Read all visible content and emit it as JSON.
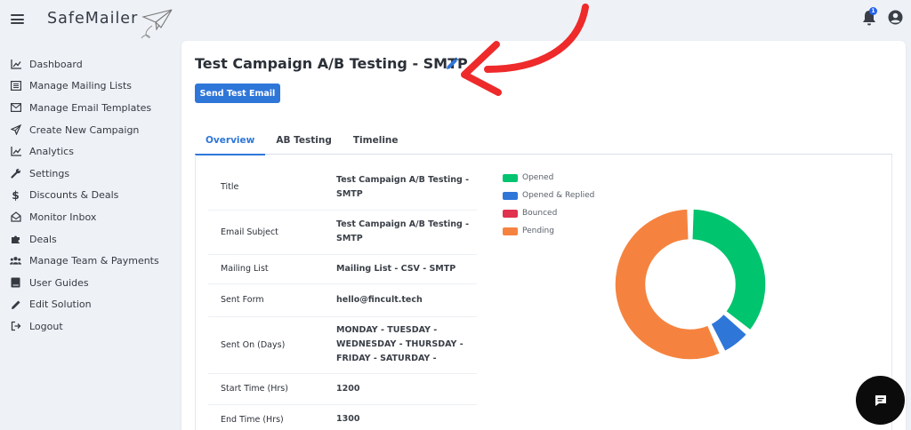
{
  "header": {
    "logo_text": "SafeMailer",
    "notification_count": "1"
  },
  "sidebar": {
    "items": [
      {
        "label": "Dashboard",
        "icon": "chart-line-icon"
      },
      {
        "label": "Manage Mailing Lists",
        "icon": "list-icon"
      },
      {
        "label": "Manage Email Templates",
        "icon": "envelope-icon"
      },
      {
        "label": "Create New Campaign",
        "icon": "paper-plane-icon"
      },
      {
        "label": "Analytics",
        "icon": "chart-line-icon"
      },
      {
        "label": "Settings",
        "icon": "wrench-icon"
      },
      {
        "label": "Discounts & Deals",
        "icon": "dollar-icon"
      },
      {
        "label": "Monitor Inbox",
        "icon": "inbox-icon"
      },
      {
        "label": "Deals",
        "icon": "puzzle-icon"
      },
      {
        "label": "Manage Team & Payments",
        "icon": "users-icon"
      },
      {
        "label": "User Guides",
        "icon": "book-icon"
      },
      {
        "label": "Edit Solution",
        "icon": "pencil-icon"
      },
      {
        "label": "Logout",
        "icon": "logout-icon"
      }
    ]
  },
  "main": {
    "title": "Test Campaign A/B Testing - SMTP",
    "send_test_label": "Send Test Email",
    "tabs": [
      {
        "label": "Overview",
        "active": true
      },
      {
        "label": "AB Testing",
        "active": false
      },
      {
        "label": "Timeline",
        "active": false
      }
    ],
    "details": [
      {
        "key": "Title",
        "value": "Test Campaign A/B Testing - SMTP"
      },
      {
        "key": "Email Subject",
        "value": "Test Campaign A/B Testing - SMTP"
      },
      {
        "key": "Mailing List",
        "value": "Mailing List - CSV - SMTP"
      },
      {
        "key": "Sent Form",
        "value": "hello@fincult.tech"
      },
      {
        "key": "Sent On (Days)",
        "value": "MONDAY - TUESDAY - WEDNESDAY - THURSDAY - FRIDAY - SATURDAY -"
      },
      {
        "key": "Start Time (Hrs)",
        "value": "1200"
      },
      {
        "key": "End Time (Hrs)",
        "value": "1300"
      }
    ]
  },
  "chart_data": {
    "type": "pie",
    "title": "",
    "legend_position": "top-left",
    "categories": [
      "Opened",
      "Opened & Replied",
      "Bounced",
      "Pending"
    ],
    "values": [
      36,
      7,
      0,
      57
    ],
    "colors": [
      "#00c46e",
      "#2f76d9",
      "#e0314f",
      "#f5833f"
    ]
  }
}
